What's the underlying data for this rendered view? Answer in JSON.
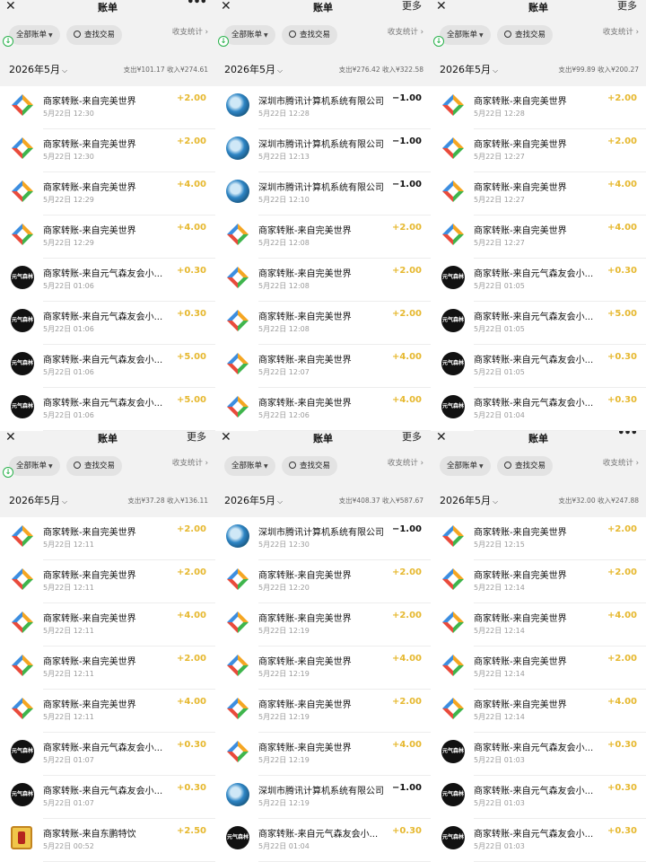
{
  "common": {
    "title": "账单",
    "more": "更多",
    "all_bills": "全部账单",
    "search": "查找交易",
    "stats": "收支统计 ›",
    "month": "2026年5月"
  },
  "icons": {
    "perfect": "perfect-world-logo-icon",
    "genki": "genki-forest-logo-icon",
    "tencent": "tencent-logo-icon",
    "dongpeng": "dongpeng-logo-icon"
  },
  "colors": {
    "income": "#e6b82f",
    "background": "#f2f2f2"
  },
  "genki_logo_text": "元气森林",
  "panels": [
    {
      "more": "dots",
      "download_badge": true,
      "summary": "支出¥101.17  收入¥274.61",
      "rows": [
        {
          "logo": "perfect",
          "name": "商家转账-来自完美世界",
          "time": "5月22日 12:30",
          "amount": "+2.00"
        },
        {
          "logo": "perfect",
          "name": "商家转账-来自完美世界",
          "time": "5月22日 12:30",
          "amount": "+2.00"
        },
        {
          "logo": "perfect",
          "name": "商家转账-来自完美世界",
          "time": "5月22日 12:29",
          "amount": "+4.00"
        },
        {
          "logo": "perfect",
          "name": "商家转账-来自完美世界",
          "time": "5月22日 12:29",
          "amount": "+4.00"
        },
        {
          "logo": "genki",
          "name": "商家转账-来自元气森友会小...",
          "time": "5月22日 01:06",
          "amount": "+0.30"
        },
        {
          "logo": "genki",
          "name": "商家转账-来自元气森友会小...",
          "time": "5月22日 01:06",
          "amount": "+0.30"
        },
        {
          "logo": "genki",
          "name": "商家转账-来自元气森友会小...",
          "time": "5月22日 01:06",
          "amount": "+5.00"
        },
        {
          "logo": "genki",
          "name": "商家转账-来自元气森友会小...",
          "time": "5月22日 01:06",
          "amount": "+5.00"
        }
      ]
    },
    {
      "more": "text",
      "download_badge": true,
      "summary": "支出¥276.42  收入¥322.58",
      "rows": [
        {
          "logo": "tencent",
          "name": "深圳市腾讯计算机系统有限公司",
          "time": "5月22日 12:28",
          "amount": "-1.00"
        },
        {
          "logo": "tencent",
          "name": "深圳市腾讯计算机系统有限公司",
          "time": "5月22日 12:13",
          "amount": "-1.00"
        },
        {
          "logo": "tencent",
          "name": "深圳市腾讯计算机系统有限公司",
          "time": "5月22日 12:10",
          "amount": "-1.00"
        },
        {
          "logo": "perfect",
          "name": "商家转账-来自完美世界",
          "time": "5月22日 12:08",
          "amount": "+2.00"
        },
        {
          "logo": "perfect",
          "name": "商家转账-来自完美世界",
          "time": "5月22日 12:08",
          "amount": "+2.00"
        },
        {
          "logo": "perfect",
          "name": "商家转账-来自完美世界",
          "time": "5月22日 12:08",
          "amount": "+2.00"
        },
        {
          "logo": "perfect",
          "name": "商家转账-来自完美世界",
          "time": "5月22日 12:07",
          "amount": "+4.00"
        },
        {
          "logo": "perfect",
          "name": "商家转账-来自完美世界",
          "time": "5月22日 12:06",
          "amount": "+4.00"
        }
      ]
    },
    {
      "more": "text",
      "download_badge": true,
      "summary": "支出¥99.89  收入¥200.27",
      "rows": [
        {
          "logo": "perfect",
          "name": "商家转账-来自完美世界",
          "time": "5月22日 12:28",
          "amount": "+2.00"
        },
        {
          "logo": "perfect",
          "name": "商家转账-来自完美世界",
          "time": "5月22日 12:27",
          "amount": "+2.00"
        },
        {
          "logo": "perfect",
          "name": "商家转账-来自完美世界",
          "time": "5月22日 12:27",
          "amount": "+4.00"
        },
        {
          "logo": "perfect",
          "name": "商家转账-来自完美世界",
          "time": "5月22日 12:27",
          "amount": "+4.00"
        },
        {
          "logo": "genki",
          "name": "商家转账-来自元气森友会小...",
          "time": "5月22日 01:05",
          "amount": "+0.30"
        },
        {
          "logo": "genki",
          "name": "商家转账-来自元气森友会小...",
          "time": "5月22日 01:05",
          "amount": "+5.00"
        },
        {
          "logo": "genki",
          "name": "商家转账-来自元气森友会小...",
          "time": "5月22日 01:05",
          "amount": "+0.30"
        },
        {
          "logo": "genki",
          "name": "商家转账-来自元气森友会小...",
          "time": "5月22日 01:04",
          "amount": "+0.30"
        }
      ]
    },
    {
      "more": "text",
      "download_badge": true,
      "summary": "支出¥37.28  收入¥136.11",
      "rows": [
        {
          "logo": "perfect",
          "name": "商家转账-来自完美世界",
          "time": "5月22日 12:11",
          "amount": "+2.00"
        },
        {
          "logo": "perfect",
          "name": "商家转账-来自完美世界",
          "time": "5月22日 12:11",
          "amount": "+2.00"
        },
        {
          "logo": "perfect",
          "name": "商家转账-来自完美世界",
          "time": "5月22日 12:11",
          "amount": "+4.00"
        },
        {
          "logo": "perfect",
          "name": "商家转账-来自完美世界",
          "time": "5月22日 12:11",
          "amount": "+2.00"
        },
        {
          "logo": "perfect",
          "name": "商家转账-来自完美世界",
          "time": "5月22日 12:11",
          "amount": "+4.00"
        },
        {
          "logo": "genki",
          "name": "商家转账-来自元气森友会小...",
          "time": "5月22日 01:07",
          "amount": "+0.30"
        },
        {
          "logo": "genki",
          "name": "商家转账-来自元气森友会小...",
          "time": "5月22日 01:07",
          "amount": "+0.30"
        },
        {
          "logo": "dongpeng",
          "name": "商家转账-来自东鹏特饮",
          "time": "5月22日 00:52",
          "amount": "+2.50"
        }
      ]
    },
    {
      "more": "text",
      "download_badge": false,
      "summary": "支出¥408.37  收入¥587.67",
      "rows": [
        {
          "logo": "tencent",
          "name": "深圳市腾讯计算机系统有限公司",
          "time": "5月22日 12:30",
          "amount": "-1.00"
        },
        {
          "logo": "perfect",
          "name": "商家转账-来自完美世界",
          "time": "5月22日 12:20",
          "amount": "+2.00"
        },
        {
          "logo": "perfect",
          "name": "商家转账-来自完美世界",
          "time": "5月22日 12:19",
          "amount": "+2.00"
        },
        {
          "logo": "perfect",
          "name": "商家转账-来自完美世界",
          "time": "5月22日 12:19",
          "amount": "+4.00"
        },
        {
          "logo": "perfect",
          "name": "商家转账-来自完美世界",
          "time": "5月22日 12:19",
          "amount": "+2.00"
        },
        {
          "logo": "perfect",
          "name": "商家转账-来自完美世界",
          "time": "5月22日 12:19",
          "amount": "+4.00"
        },
        {
          "logo": "tencent",
          "name": "深圳市腾讯计算机系统有限公司",
          "time": "5月22日 12:19",
          "amount": "-1.00"
        },
        {
          "logo": "genki",
          "name": "商家转账-来自元气森友会小...",
          "time": "5月22日 01:04",
          "amount": "+0.30"
        }
      ]
    },
    {
      "more": "dots",
      "download_badge": false,
      "summary": "支出¥32.00  收入¥247.88",
      "rows": [
        {
          "logo": "perfect",
          "name": "商家转账-来自完美世界",
          "time": "5月22日 12:15",
          "amount": "+2.00"
        },
        {
          "logo": "perfect",
          "name": "商家转账-来自完美世界",
          "time": "5月22日 12:14",
          "amount": "+2.00"
        },
        {
          "logo": "perfect",
          "name": "商家转账-来自完美世界",
          "time": "5月22日 12:14",
          "amount": "+4.00"
        },
        {
          "logo": "perfect",
          "name": "商家转账-来自完美世界",
          "time": "5月22日 12:14",
          "amount": "+2.00"
        },
        {
          "logo": "perfect",
          "name": "商家转账-来自完美世界",
          "time": "5月22日 12:14",
          "amount": "+4.00"
        },
        {
          "logo": "genki",
          "name": "商家转账-来自元气森友会小...",
          "time": "5月22日 01:03",
          "amount": "+0.30"
        },
        {
          "logo": "genki",
          "name": "商家转账-来自元气森友会小...",
          "time": "5月22日 01:03",
          "amount": "+0.30"
        },
        {
          "logo": "genki",
          "name": "商家转账-来自元气森友会小...",
          "time": "5月22日 01:03",
          "amount": "+0.30"
        }
      ]
    }
  ]
}
